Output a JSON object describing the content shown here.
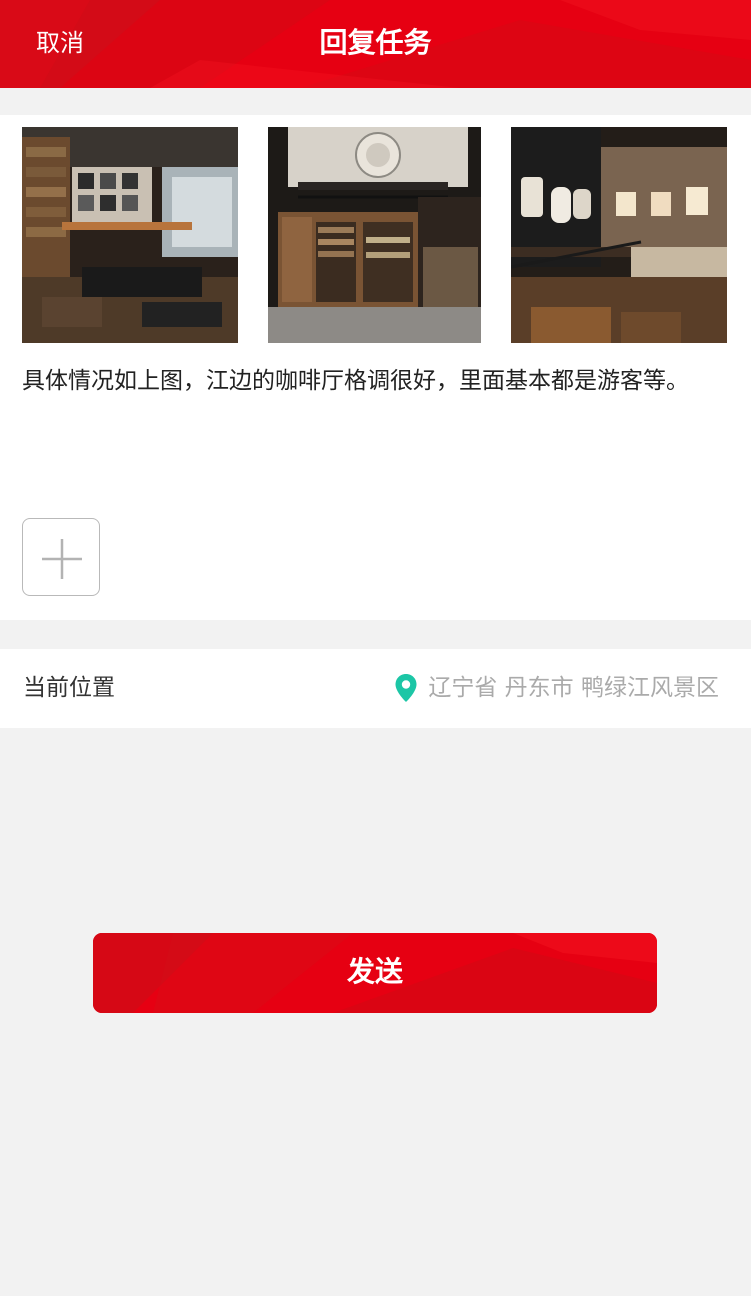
{
  "header": {
    "cancel_label": "取消",
    "title": "回复任务"
  },
  "content": {
    "photos": [
      {
        "name": "photo-cafe-interior-1"
      },
      {
        "name": "photo-cafe-interior-2"
      },
      {
        "name": "photo-cafe-interior-3"
      }
    ],
    "description": "具体情况如上图，江边的咖啡厅格调很好，里面基本都是游客等。",
    "add_icon": "plus-icon"
  },
  "location": {
    "label": "当前位置",
    "icon": "location-pin-icon",
    "value": "辽宁省 丹东市 鸭绿江风景区"
  },
  "send": {
    "label": "发送"
  },
  "colors": {
    "brand_red": "#e60012",
    "pin_teal": "#1cc6a6",
    "background": "#f2f2f2"
  }
}
